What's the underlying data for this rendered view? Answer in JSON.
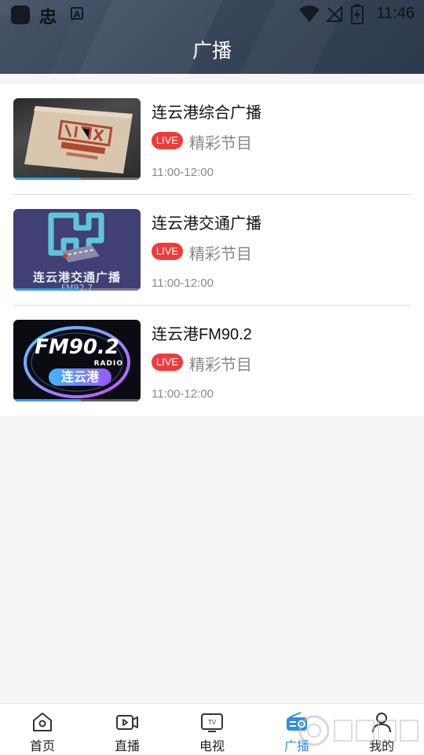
{
  "status_bar": {
    "time": "11:46",
    "app_badge": "A"
  },
  "header": {
    "title": "广播"
  },
  "items": [
    {
      "title": "连云港综合广播",
      "live": "LIVE",
      "program": "精彩节目",
      "time": "11:00-12:00"
    },
    {
      "title": "连云港交通广播",
      "live": "LIVE",
      "program": "精彩节目",
      "time": "11:00-12:00",
      "logo_text": "连云港交通广播",
      "logo_sub": "FM92.7"
    },
    {
      "title": "连云港FM90.2",
      "live": "LIVE",
      "program": "精彩节目",
      "time": "11:00-12:00",
      "logo_fm": "FM90.2",
      "logo_radio": "RADIO",
      "logo_city": "连云港"
    }
  ],
  "bottom_nav": [
    {
      "label": "首页",
      "icon": "home-icon"
    },
    {
      "label": "直播",
      "icon": "live-video-icon"
    },
    {
      "label": "电视",
      "icon": "tv-icon"
    },
    {
      "label": "广播",
      "icon": "radio-icon",
      "active": true
    },
    {
      "label": "我的",
      "icon": "user-icon"
    }
  ],
  "colors": {
    "accent": "#2f8de4",
    "live_badge": "#ef3b3b",
    "header_bg": "#3b475b"
  }
}
